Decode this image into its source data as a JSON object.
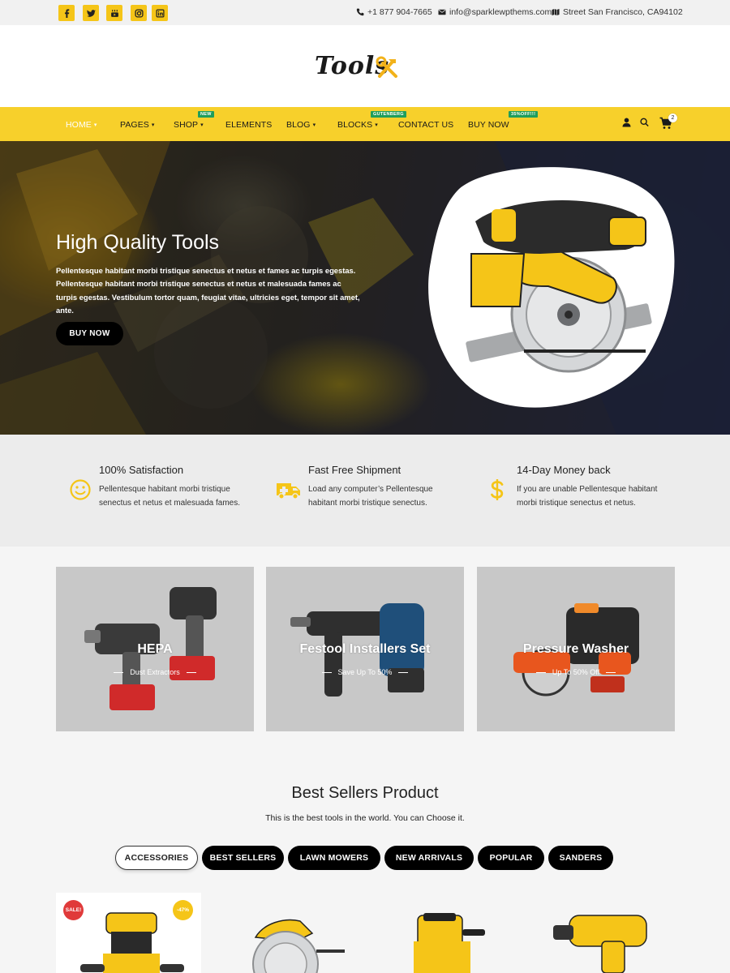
{
  "topbar": {
    "social": [
      "facebook-icon",
      "twitter-icon",
      "youtube-icon",
      "instagram-icon",
      "linkedin-icon"
    ],
    "phone": "+1 877 904-7665",
    "email": "info@sparklewpthems.com",
    "address": "Street San Francisco, CA94102"
  },
  "logo": {
    "text": "Tools"
  },
  "nav": {
    "items": [
      {
        "label": "HOME",
        "chevron": "⌄"
      },
      {
        "label": "PAGES",
        "chevron": "⌄"
      },
      {
        "label": "SHOP",
        "chevron": "⌄",
        "badge": "NEW"
      },
      {
        "label": "ELEMENTS"
      },
      {
        "label": "BLOG",
        "chevron": "⌄"
      },
      {
        "label": "BLOCKS",
        "chevron": "⌄",
        "badge": "GUTENBERG"
      },
      {
        "label": "CONTACT US"
      },
      {
        "label": "BUY NOW",
        "badge": "35%OFF!!!"
      }
    ],
    "cart_count": "2"
  },
  "hero": {
    "title": "High Quality Tools",
    "text": "Pellentesque habitant morbi tristique senectus et netus et fames ac turpis egestas. Pellentesque habitant morbi tristique senectus et netus et malesuada fames ac turpis egestas. Vestibulum tortor quam, feugiat vitae, ultricies eget, tempor sit amet, ante.",
    "button": "BUY NOW"
  },
  "features": [
    {
      "icon": "smiley-icon",
      "title": "100% Satisfaction",
      "text": "Pellentesque habitant morbi tristique senectus et netus et malesuada fames."
    },
    {
      "icon": "ambulance-truck-icon",
      "title": "Fast Free Shipment",
      "text": "Load any computer’s Pellentesque habitant morbi tristique senectus."
    },
    {
      "icon": "dollar-icon",
      "title": "14-Day Money back",
      "text": "If you are unable Pellentesque habitant morbi tristique senectus et netus."
    }
  ],
  "promos": [
    {
      "title": "HEPA",
      "sub": "Dust Extractors"
    },
    {
      "title": "Festool Installers Set",
      "sub": "Save Up To 50%"
    },
    {
      "title": "Pressure Washer",
      "sub": "Up To 50% Off"
    }
  ],
  "best": {
    "title": "Best Sellers Product",
    "subtitle": "This is the best tools in the world. You can Choose it.",
    "tabs": [
      "ACCESSORIES",
      "BEST SELLERS",
      "LAWN MOWERS",
      "NEW ARRIVALS",
      "POPULAR",
      "SANDERS"
    ]
  },
  "products": [
    {
      "sale": "SALE!",
      "discount": "-47%"
    }
  ],
  "colors": {
    "accent": "#f7d02b",
    "dark": "#000000",
    "badge_green": "#1f9e5c",
    "sale_red": "#e03a3a"
  }
}
